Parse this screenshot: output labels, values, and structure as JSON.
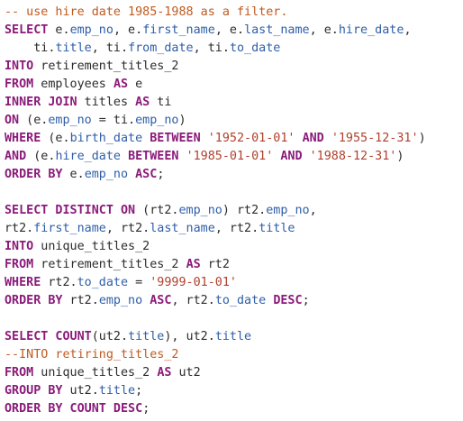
{
  "editor": {
    "colors": {
      "keyword": "#8b1a7a",
      "column": "#2e5ea8",
      "string": "#b0402c",
      "comment": "#c05a1f",
      "text": "#2b2b2b",
      "background": "#ffffff"
    },
    "lines": [
      {
        "tokens": [
          {
            "t": "-- use hire date 1985-1988 as a filter.",
            "c": "cmt"
          }
        ]
      },
      {
        "tokens": [
          {
            "t": "SELECT",
            "c": "kw"
          },
          {
            "t": " e.",
            "c": "txt"
          },
          {
            "t": "emp_no",
            "c": "col"
          },
          {
            "t": ", e.",
            "c": "txt"
          },
          {
            "t": "first_name",
            "c": "col"
          },
          {
            "t": ", e.",
            "c": "txt"
          },
          {
            "t": "last_name",
            "c": "col"
          },
          {
            "t": ", e.",
            "c": "txt"
          },
          {
            "t": "hire_date",
            "c": "col"
          },
          {
            "t": ",",
            "c": "txt"
          }
        ]
      },
      {
        "tokens": [
          {
            "t": "    ti.",
            "c": "txt"
          },
          {
            "t": "title",
            "c": "col"
          },
          {
            "t": ", ti.",
            "c": "txt"
          },
          {
            "t": "from_date",
            "c": "col"
          },
          {
            "t": ", ti.",
            "c": "txt"
          },
          {
            "t": "to_date",
            "c": "col"
          }
        ]
      },
      {
        "tokens": [
          {
            "t": "INTO",
            "c": "kw"
          },
          {
            "t": " retirement_titles_2",
            "c": "txt"
          }
        ]
      },
      {
        "tokens": [
          {
            "t": "FROM",
            "c": "kw"
          },
          {
            "t": " employees ",
            "c": "txt"
          },
          {
            "t": "AS",
            "c": "kw"
          },
          {
            "t": " e",
            "c": "txt"
          }
        ]
      },
      {
        "tokens": [
          {
            "t": "INNER JOIN",
            "c": "kw"
          },
          {
            "t": " titles ",
            "c": "txt"
          },
          {
            "t": "AS",
            "c": "kw"
          },
          {
            "t": " ti",
            "c": "txt"
          }
        ]
      },
      {
        "tokens": [
          {
            "t": "ON",
            "c": "kw"
          },
          {
            "t": " (e.",
            "c": "txt"
          },
          {
            "t": "emp_no",
            "c": "col"
          },
          {
            "t": " = ti.",
            "c": "txt"
          },
          {
            "t": "emp_no",
            "c": "col"
          },
          {
            "t": ")",
            "c": "txt"
          }
        ]
      },
      {
        "tokens": [
          {
            "t": "WHERE",
            "c": "kw"
          },
          {
            "t": " (e.",
            "c": "txt"
          },
          {
            "t": "birth_date",
            "c": "col"
          },
          {
            "t": " ",
            "c": "txt"
          },
          {
            "t": "BETWEEN",
            "c": "kw"
          },
          {
            "t": " ",
            "c": "txt"
          },
          {
            "t": "'1952-01-01'",
            "c": "str"
          },
          {
            "t": " ",
            "c": "txt"
          },
          {
            "t": "AND",
            "c": "kw"
          },
          {
            "t": " ",
            "c": "txt"
          },
          {
            "t": "'1955-12-31'",
            "c": "str"
          },
          {
            "t": ")",
            "c": "txt"
          }
        ]
      },
      {
        "tokens": [
          {
            "t": "AND",
            "c": "kw"
          },
          {
            "t": " (e.",
            "c": "txt"
          },
          {
            "t": "hire_date",
            "c": "col"
          },
          {
            "t": " ",
            "c": "txt"
          },
          {
            "t": "BETWEEN",
            "c": "kw"
          },
          {
            "t": " ",
            "c": "txt"
          },
          {
            "t": "'1985-01-01'",
            "c": "str"
          },
          {
            "t": " ",
            "c": "txt"
          },
          {
            "t": "AND",
            "c": "kw"
          },
          {
            "t": " ",
            "c": "txt"
          },
          {
            "t": "'1988-12-31'",
            "c": "str"
          },
          {
            "t": ")",
            "c": "txt"
          }
        ]
      },
      {
        "tokens": [
          {
            "t": "ORDER BY",
            "c": "kw"
          },
          {
            "t": " e.",
            "c": "txt"
          },
          {
            "t": "emp_no",
            "c": "col"
          },
          {
            "t": " ",
            "c": "txt"
          },
          {
            "t": "ASC",
            "c": "kw"
          },
          {
            "t": ";",
            "c": "txt"
          }
        ]
      },
      {
        "tokens": []
      },
      {
        "tokens": [
          {
            "t": "SELECT DISTINCT ON",
            "c": "kw"
          },
          {
            "t": " (rt2.",
            "c": "txt"
          },
          {
            "t": "emp_no",
            "c": "col"
          },
          {
            "t": ") rt2.",
            "c": "txt"
          },
          {
            "t": "emp_no",
            "c": "col"
          },
          {
            "t": ",",
            "c": "txt"
          }
        ]
      },
      {
        "tokens": [
          {
            "t": "rt2.",
            "c": "txt"
          },
          {
            "t": "first_name",
            "c": "col"
          },
          {
            "t": ", rt2.",
            "c": "txt"
          },
          {
            "t": "last_name",
            "c": "col"
          },
          {
            "t": ", rt2.",
            "c": "txt"
          },
          {
            "t": "title",
            "c": "col"
          }
        ]
      },
      {
        "tokens": [
          {
            "t": "INTO",
            "c": "kw"
          },
          {
            "t": " unique_titles_2",
            "c": "txt"
          }
        ]
      },
      {
        "tokens": [
          {
            "t": "FROM",
            "c": "kw"
          },
          {
            "t": " retirement_titles_2 ",
            "c": "txt"
          },
          {
            "t": "AS",
            "c": "kw"
          },
          {
            "t": " rt2",
            "c": "txt"
          }
        ]
      },
      {
        "tokens": [
          {
            "t": "WHERE",
            "c": "kw"
          },
          {
            "t": " rt2.",
            "c": "txt"
          },
          {
            "t": "to_date",
            "c": "col"
          },
          {
            "t": " = ",
            "c": "txt"
          },
          {
            "t": "'9999-01-01'",
            "c": "str"
          }
        ]
      },
      {
        "tokens": [
          {
            "t": "ORDER BY",
            "c": "kw"
          },
          {
            "t": " rt2.",
            "c": "txt"
          },
          {
            "t": "emp_no",
            "c": "col"
          },
          {
            "t": " ",
            "c": "txt"
          },
          {
            "t": "ASC",
            "c": "kw"
          },
          {
            "t": ", rt2.",
            "c": "txt"
          },
          {
            "t": "to_date",
            "c": "col"
          },
          {
            "t": " ",
            "c": "txt"
          },
          {
            "t": "DESC",
            "c": "kw"
          },
          {
            "t": ";",
            "c": "txt"
          }
        ]
      },
      {
        "tokens": []
      },
      {
        "tokens": [
          {
            "t": "SELECT COUNT",
            "c": "kw"
          },
          {
            "t": "(ut2.",
            "c": "txt"
          },
          {
            "t": "title",
            "c": "col"
          },
          {
            "t": "), ut2.",
            "c": "txt"
          },
          {
            "t": "title",
            "c": "col"
          }
        ]
      },
      {
        "tokens": [
          {
            "t": "--INTO retiring_titles_2",
            "c": "cmt"
          }
        ]
      },
      {
        "tokens": [
          {
            "t": "FROM",
            "c": "kw"
          },
          {
            "t": " unique_titles_2 ",
            "c": "txt"
          },
          {
            "t": "AS",
            "c": "kw"
          },
          {
            "t": " ut2",
            "c": "txt"
          }
        ]
      },
      {
        "tokens": [
          {
            "t": "GROUP BY",
            "c": "kw"
          },
          {
            "t": " ut2.",
            "c": "txt"
          },
          {
            "t": "title",
            "c": "col"
          },
          {
            "t": ";",
            "c": "txt"
          }
        ]
      },
      {
        "tokens": [
          {
            "t": "ORDER BY COUNT DESC",
            "c": "kw"
          },
          {
            "t": ";",
            "c": "txt"
          }
        ]
      }
    ]
  }
}
